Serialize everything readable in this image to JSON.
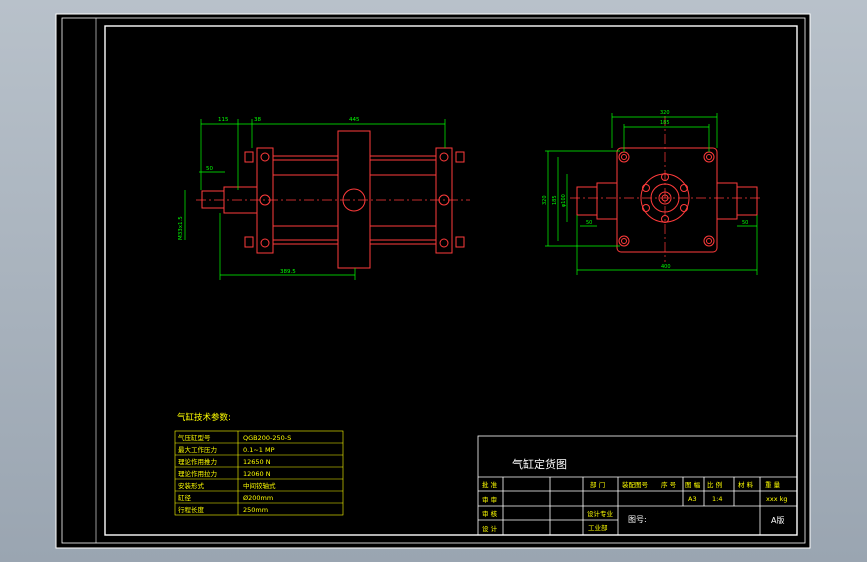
{
  "colors": {
    "paper": "#000000",
    "frame": "#ffffff",
    "part": "#ff3b3b",
    "dimension": "#00ff00",
    "centerline": "#ff3b3b",
    "table_text": "#ffff00",
    "title_text": "#ffffff"
  },
  "front_view": {
    "dim_top_1": "115",
    "dim_top_2": "38",
    "dim_top_3": "445",
    "dim_left_stub": "50",
    "dim_thread": "M33x1.5",
    "dim_bottom": "389.5"
  },
  "side_view": {
    "dim_top_outer": "320",
    "dim_top_inner": "185",
    "dim_left_outer": "320",
    "dim_left_inner": "185",
    "dim_left_bore": "φ100",
    "dim_stub_left": "50",
    "dim_stub_right": "50",
    "dim_bottom": "400"
  },
  "params": {
    "title": "气缸技术参数:",
    "rows": [
      {
        "label": "气压缸型号",
        "value": "QGB200-250-S"
      },
      {
        "label": "最大工作压力",
        "value": "0.1~1 MP"
      },
      {
        "label": "理论作用推力",
        "value": "12650 N"
      },
      {
        "label": "理论作用拉力",
        "value": "12060 N"
      },
      {
        "label": "安装形式",
        "value": "中间铰轴式"
      },
      {
        "label": "缸径",
        "value": "Ø200mm"
      },
      {
        "label": "行程长度",
        "value": "250mm"
      }
    ]
  },
  "title_block": {
    "drawing_name": "气缸定货图",
    "row_labels": [
      "批 准",
      "审 审",
      "审 核",
      "设 计"
    ],
    "header": [
      "部 门",
      "装配图号",
      "序 号",
      "图 幅",
      "比 例",
      "材 料",
      "重 量"
    ],
    "values": {
      "sheet": "A3",
      "scale": "1:4",
      "weight": "xxx kg"
    },
    "dept_1": "设计专业",
    "dept_2": "工业部",
    "drawing_no_label": "图号:",
    "version": "A版"
  }
}
